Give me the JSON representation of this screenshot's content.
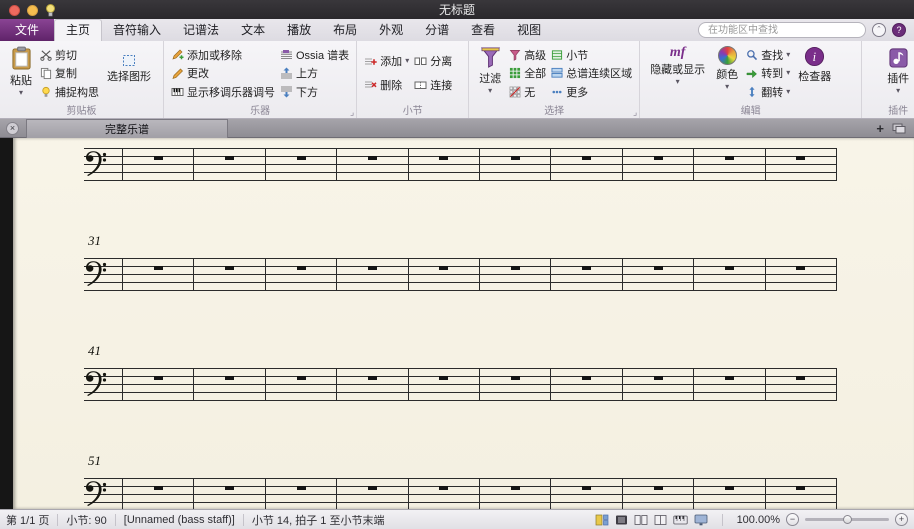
{
  "window": {
    "title": "无标题"
  },
  "ribbon_tabs": {
    "file": "文件",
    "items": [
      "主页",
      "音符输入",
      "记谱法",
      "文本",
      "播放",
      "布局",
      "外观",
      "分谱",
      "查看",
      "视图"
    ],
    "active": "主页",
    "search_placeholder": "在功能区中查找"
  },
  "ribbon": {
    "clipboard": {
      "label": "剪贴板",
      "paste": "粘贴",
      "cut": "剪切",
      "copy": "复制",
      "capture_idea": "捕捉构思",
      "select_graphic": "选择图形"
    },
    "instruments": {
      "label": "乐器",
      "add_or_remove": "添加或移除",
      "change": "更改",
      "transposing": "显示移调乐器调号",
      "ossia": "Ossia 谱表",
      "above": "上方",
      "below": "下方"
    },
    "bars": {
      "label": "小节",
      "add": "添加",
      "delete": "删除",
      "split": "分离",
      "join": "连接"
    },
    "select": {
      "label": "选择",
      "filter": "过滤",
      "advanced": "高级",
      "all": "全部",
      "none": "无",
      "bars": "小节",
      "passage": "总谱连续区域",
      "more": "更多"
    },
    "editing": {
      "label": "编辑",
      "hide_show": "隐藏或显示",
      "color": "颜色",
      "find": "查找",
      "goto": "转到",
      "flip": "翻转",
      "inspector": "检查器"
    },
    "plugins": {
      "label": "插件",
      "plugins_btn": "插件"
    }
  },
  "document_tabs": {
    "active": "完整乐谱"
  },
  "score": {
    "paper_color": "#f8f4e8",
    "clef": "bass",
    "systems": [
      {
        "bar_number": "",
        "measures": 10
      },
      {
        "bar_number": "31",
        "measures": 10
      },
      {
        "bar_number": "41",
        "measures": 10
      },
      {
        "bar_number": "51",
        "measures": 10
      }
    ]
  },
  "status_bar": {
    "page": "第 1/1 页",
    "bar_count": "小节: 90",
    "staff_name": "[Unnamed (bass staff)]",
    "selection": "小节 14, 拍子 1 至小节末端",
    "zoom": "100.00%"
  },
  "colors": {
    "accent_purple": "#6b2d79",
    "paper": "#f8f4e8",
    "titlebar": "#2d2b2e"
  },
  "icons": {
    "caret": "▾",
    "dialog_launcher": "⌟",
    "close": "×",
    "add_tab": "+",
    "minus": "−",
    "plus": "+",
    "collapse": "ˆ",
    "help": "?"
  }
}
